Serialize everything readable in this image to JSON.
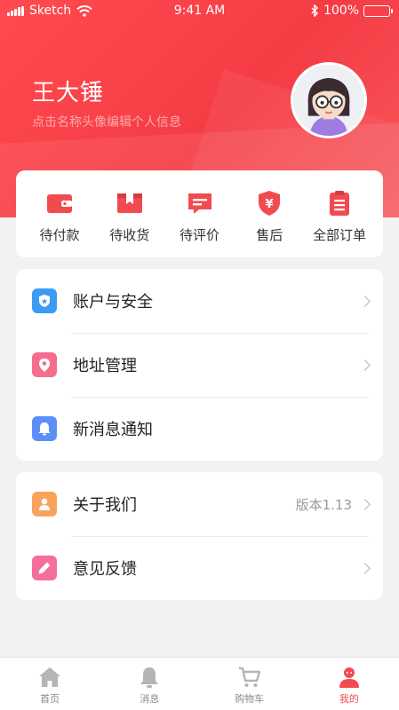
{
  "status_bar": {
    "carrier": "Sketch",
    "time": "9:41 AM",
    "battery": "100%"
  },
  "profile": {
    "name": "王大锤",
    "subtitle": "点击名称头像编辑个人信息"
  },
  "orders": [
    {
      "label": "待付款",
      "icon": "wallet-icon"
    },
    {
      "label": "待收货",
      "icon": "package-icon"
    },
    {
      "label": "待评价",
      "icon": "comment-icon"
    },
    {
      "label": "售后",
      "icon": "after-sale-shield-icon"
    },
    {
      "label": "全部订单",
      "icon": "clipboard-icon"
    }
  ],
  "menu_group_1": [
    {
      "label": "账户与安全",
      "icon": "shield-icon",
      "color": "#3d9bf5"
    },
    {
      "label": "地址管理",
      "icon": "location-pin-icon",
      "color": "#f46e8d"
    },
    {
      "label": "新消息通知",
      "icon": "bell-icon",
      "color": "#5b8ff5"
    }
  ],
  "menu_group_2": [
    {
      "label": "关于我们",
      "icon": "person-icon",
      "color": "#f7a35c",
      "value": "版本1.13"
    },
    {
      "label": "意见反馈",
      "icon": "pencil-icon",
      "color": "#f46e9e"
    }
  ],
  "tabs": [
    {
      "label": "首页",
      "icon": "home-icon"
    },
    {
      "label": "消息",
      "icon": "bell-icon"
    },
    {
      "label": "购物车",
      "icon": "cart-icon"
    },
    {
      "label": "我的",
      "icon": "user-icon",
      "active": true
    }
  ],
  "colors": {
    "brand": "#f53c45",
    "tab_active": "#f24b4f"
  }
}
